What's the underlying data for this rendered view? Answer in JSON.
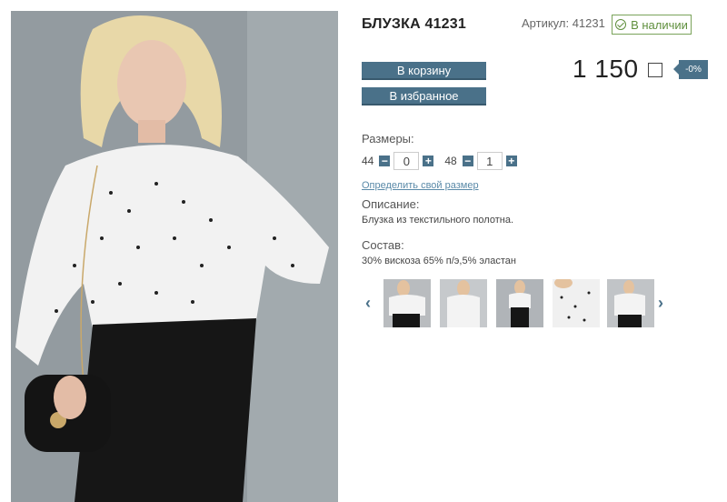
{
  "product": {
    "title": "БЛУЗКА 41231",
    "sku_label": "Артикул: 41231",
    "stock_label": "В наличии",
    "price": "1 150",
    "discount": "-0%"
  },
  "actions": {
    "cart_label": "В корзину",
    "favorite_label": "В избранное"
  },
  "sizes": {
    "label": "Размеры:",
    "items": [
      {
        "size": "44",
        "qty": "0"
      },
      {
        "size": "48",
        "qty": "1"
      }
    ],
    "minus": "−",
    "plus": "+",
    "link": "Определить свой размер"
  },
  "description": {
    "label": "Описание:",
    "text": "Блузка из текстильного полотна."
  },
  "composition": {
    "label": "Состав:",
    "text": "30% вискоза 65% п/э,5% эластан"
  },
  "gallery": {
    "prev_icon": "chevron-left-icon",
    "next_icon": "chevron-right-icon",
    "prev_glyph": "‹",
    "next_glyph": "›"
  },
  "colors": {
    "accent": "#4a7189",
    "stock_green": "#5f8f3d",
    "link": "#5a8aa8"
  }
}
